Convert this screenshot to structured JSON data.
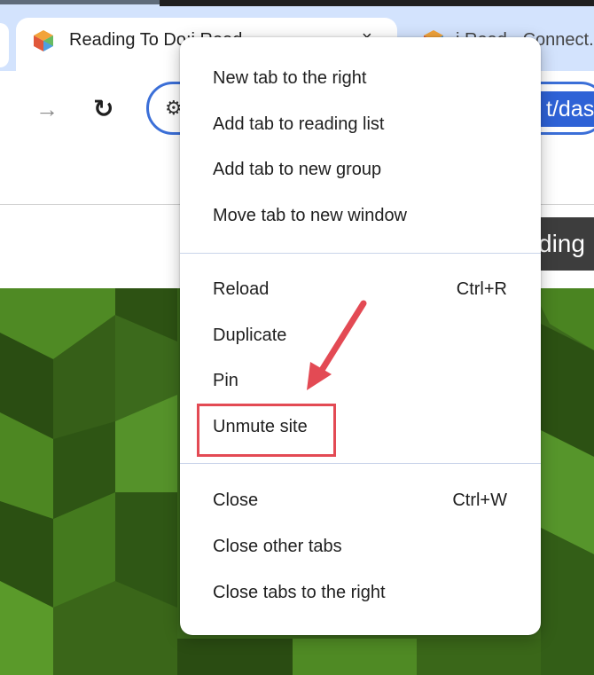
{
  "browser": {
    "active_tab": {
      "title": "Reading To Do:i Read...",
      "icon": "cube-favicon-icon",
      "close_label": "×"
    },
    "inactive_tab": {
      "title": "i Read - Connect...",
      "icon": "cube-favicon-icon"
    },
    "toolbar": {
      "forward_icon": "→",
      "reload_icon": "↻",
      "site_info_icon": "⚙",
      "url_visible_fragment": "t/dash"
    }
  },
  "page": {
    "header_fragment": "ding"
  },
  "context_menu": {
    "groups": [
      [
        {
          "label": "New tab to the right",
          "shortcut": ""
        },
        {
          "label": "Add tab to reading list",
          "shortcut": ""
        },
        {
          "label": "Add tab to new group",
          "shortcut": ""
        },
        {
          "label": "Move tab to new window",
          "shortcut": ""
        }
      ],
      [
        {
          "label": "Reload",
          "shortcut": "Ctrl+R"
        },
        {
          "label": "Duplicate",
          "shortcut": ""
        },
        {
          "label": "Pin",
          "shortcut": ""
        },
        {
          "label": "Unmute site",
          "shortcut": ""
        }
      ],
      [
        {
          "label": "Close",
          "shortcut": "Ctrl+W"
        },
        {
          "label": "Close other tabs",
          "shortcut": ""
        },
        {
          "label": "Close tabs to the right",
          "shortcut": ""
        }
      ]
    ]
  },
  "annotation": {
    "highlighted_item": "Unmute site",
    "color": "#e34a54"
  },
  "colors": {
    "tabstrip": "#d3e3fd",
    "accent": "#2e62d6",
    "hero_green": "#3f6b1e"
  }
}
